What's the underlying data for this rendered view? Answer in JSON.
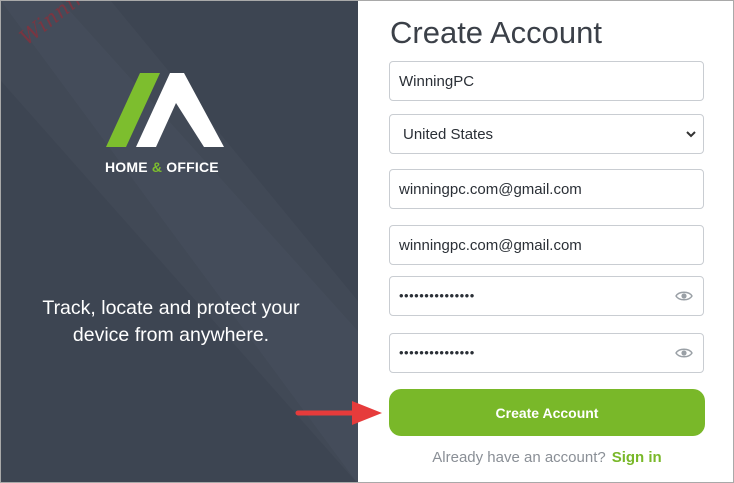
{
  "left_panel": {
    "watermark": "WinningPC",
    "brand": {
      "prefix": "HOME ",
      "amp": "&",
      "suffix": " OFFICE"
    },
    "tagline": "Track, locate and protect your device from anywhere."
  },
  "form": {
    "title": "Create Account",
    "name_value": "WinningPC",
    "country_value": "United States",
    "email_value": "winningpc.com@gmail.com",
    "confirm_email_value": "winningpc.com@gmail.com",
    "password_masked": "•••••••••••••••",
    "confirm_password_masked": "•••••••••••••••",
    "create_button_label": "Create Account",
    "already_text": "Already have an account?",
    "signin_label": "Sign in"
  },
  "colors": {
    "panel_bg": "#3d4552",
    "accent_green": "#79b829",
    "arrow_red": "#e63b3b"
  },
  "icons": {
    "logo": "home-office-logo",
    "eye": "eye-icon",
    "select": "chevron-down-icon",
    "arrow": "red-arrow-annotation"
  }
}
